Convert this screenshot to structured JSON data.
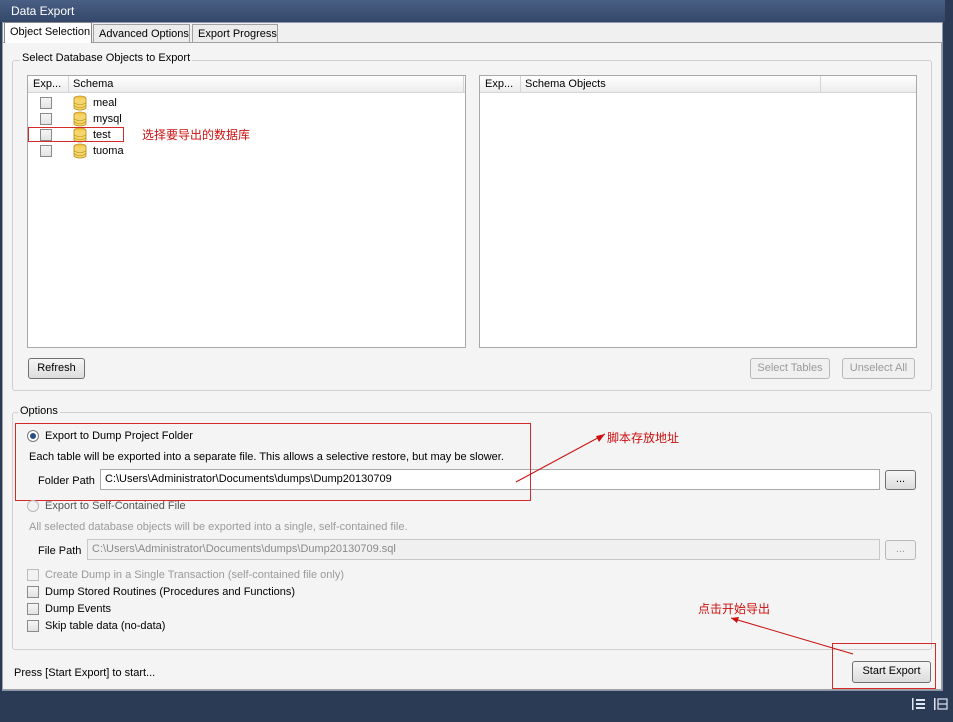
{
  "window": {
    "title": "Data Export"
  },
  "tabs": [
    {
      "label": "Object Selection",
      "active": true
    },
    {
      "label": "Advanced Options",
      "active": false
    },
    {
      "label": "Export Progress",
      "active": false
    }
  ],
  "select_group": {
    "title": "Select Database Objects to Export",
    "schema_list": {
      "columns": [
        "Exp...",
        "Schema"
      ],
      "rows": [
        {
          "name": "meal",
          "checked": false
        },
        {
          "name": "mysql",
          "checked": false
        },
        {
          "name": "test",
          "checked": false
        },
        {
          "name": "tuoma",
          "checked": false
        }
      ]
    },
    "objects_list": {
      "columns": [
        "Exp...",
        "Schema Objects"
      ]
    },
    "refresh_label": "Refresh",
    "select_tables_label": "Select Tables",
    "unselect_all_label": "Unselect All"
  },
  "options_group": {
    "title": "Options",
    "dump_folder": {
      "label": "Export to Dump Project Folder",
      "selected": true,
      "description": "Each table will be exported into a separate file. This allows a selective restore, but may be slower.",
      "path_label": "Folder Path",
      "path_value": "C:\\Users\\Administrator\\Documents\\dumps\\Dump20130709",
      "browse_label": "..."
    },
    "self_contained": {
      "label": "Export to Self-Contained File",
      "selected": false,
      "description": "All selected database objects will be exported into a single, self-contained file.",
      "path_label": "File Path",
      "path_value": "C:\\Users\\Administrator\\Documents\\dumps\\Dump20130709.sql",
      "browse_label": "..."
    },
    "checkboxes": [
      {
        "label": "Create Dump in a Single Transaction (self-contained file only)",
        "checked": false,
        "enabled": false
      },
      {
        "label": "Dump Stored Routines (Procedures and Functions)",
        "checked": false,
        "enabled": true
      },
      {
        "label": "Dump Events",
        "checked": false,
        "enabled": true
      },
      {
        "label": "Skip table data (no-data)",
        "checked": false,
        "enabled": true
      }
    ]
  },
  "footer": {
    "status_text": "Press [Start Export] to start...",
    "start_export_label": "Start Export"
  },
  "annotations": {
    "select_db": "选择要导出的数据库",
    "script_path": "脚本存放地址",
    "click_start": "点击开始导出"
  },
  "colors": {
    "annotation": "#cc1010",
    "titlebar": "#3d5178",
    "radio_dot": "#2a4d8a"
  }
}
